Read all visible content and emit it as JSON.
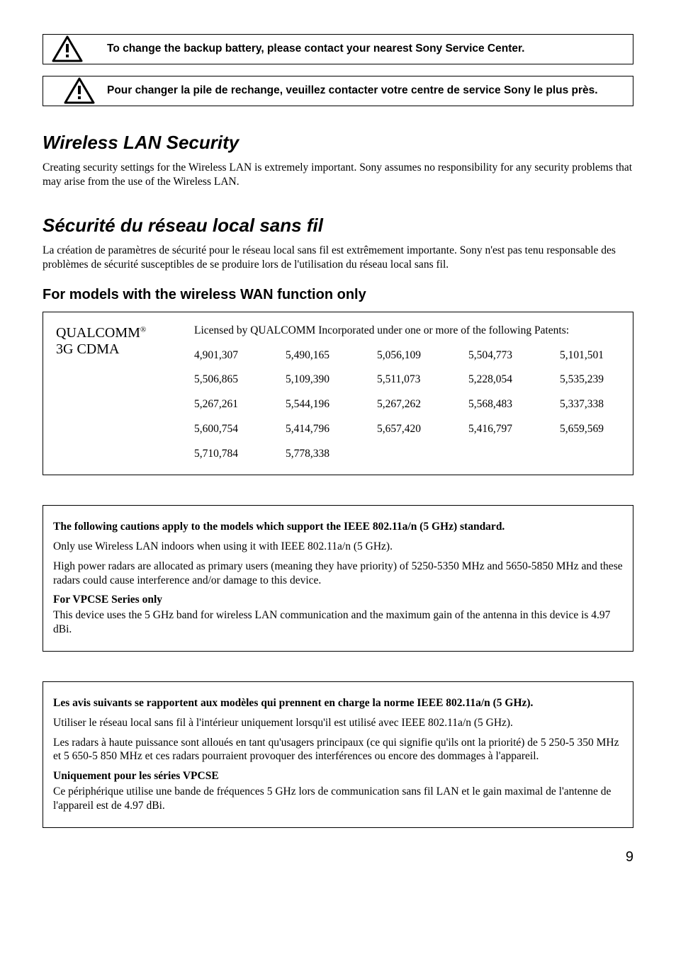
{
  "warn1": {
    "msg": "To change the backup battery, please contact your nearest Sony Service Center."
  },
  "warn2": {
    "msg": "Pour changer la pile de rechange, veuillez contacter votre centre de service Sony le plus près."
  },
  "sec_wlan": {
    "heading": "Wireless LAN Security",
    "para": "Creating security settings for the Wireless LAN is extremely important. Sony assumes no responsibility for any security problems that may arise from the use of the Wireless LAN."
  },
  "sec_wlan_fr": {
    "heading": "Sécurité du réseau local sans fil",
    "para": "La création de paramètres de sécurité pour le réseau local sans fil est extrêmement importante. Sony n'est pas tenu responsable des problèmes de sécurité susceptibles de se produire lors de l'utilisation du réseau local sans fil."
  },
  "wwan": {
    "heading": "For models with the wireless WAN function only",
    "brand_line1": "QUALCOMM",
    "brand_reg": "®",
    "brand_line2": "3G CDMA",
    "intro": "Licensed by QUALCOMM Incorporated under one or more of the following Patents:",
    "patents": [
      [
        "4,901,307",
        "5,490,165",
        "5,056,109",
        "5,504,773",
        "5,101,501"
      ],
      [
        "5,506,865",
        "5,109,390",
        "5,511,073",
        "5,228,054",
        "5,535,239"
      ],
      [
        "5,267,261",
        "5,544,196",
        "5,267,262",
        "5,568,483",
        "5,337,338"
      ],
      [
        "5,600,754",
        "5,414,796",
        "5,657,420",
        "5,416,797",
        "5,659,569"
      ],
      [
        "5,710,784",
        "5,778,338",
        "",
        "",
        ""
      ]
    ]
  },
  "note_en": {
    "bold_intro": "The following cautions apply to the models which support the IEEE 802.11a/n (5 GHz) standard.",
    "p1": "Only use Wireless LAN indoors when using it with IEEE 802.11a/n (5 GHz).",
    "p2": "High power radars are allocated as primary users (meaning they have priority) of 5250-5350 MHz and 5650-5850 MHz and these radars could cause interference and/or damage to this device.",
    "sub_bold": "For VPCSE Series only",
    "sub_text": "This device uses the 5 GHz band for wireless LAN communication and the maximum gain of the antenna in this device is 4.97 dBi."
  },
  "note_fr": {
    "bold_intro": "Les avis suivants se rapportent aux modèles qui prennent en charge la norme IEEE 802.11a/n (5 GHz).",
    "p1": "Utiliser le réseau local sans fil à l'intérieur uniquement lorsqu'il est utilisé avec IEEE 802.11a/n (5 GHz).",
    "p2": "Les radars à haute puissance sont alloués en tant qu'usagers principaux (ce qui signifie qu'ils ont la priorité) de 5 250-5 350 MHz et 5 650-5 850 MHz et ces radars pourraient provoquer des interférences ou encore des dommages à l'appareil.",
    "sub_bold": "Uniquement pour les séries VPCSE",
    "sub_text": "Ce périphérique utilise une bande de fréquences 5 GHz lors de communication sans fil LAN et le gain maximal de l'antenne de l'appareil est de 4.97 dBi."
  },
  "page_number": "9"
}
